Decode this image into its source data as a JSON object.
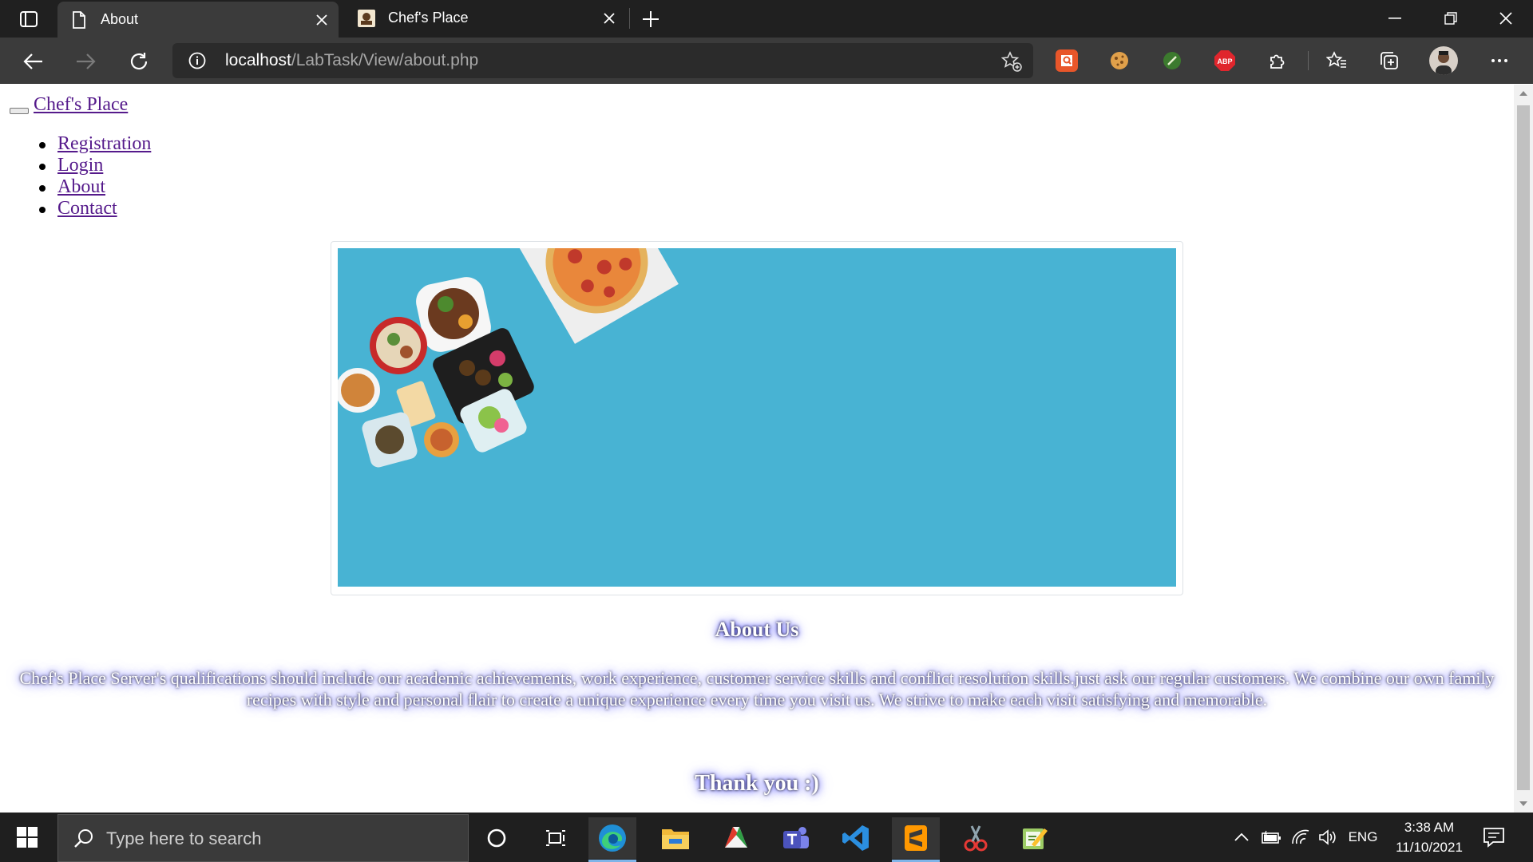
{
  "browser": {
    "tabs": [
      {
        "title": "About",
        "active": true
      },
      {
        "title": "Chef's Place",
        "active": false
      }
    ],
    "address": {
      "host": "localhost",
      "path": "/LabTask/View/about.php"
    },
    "extensions": [
      "search-extension-icon",
      "cookie-extension-icon",
      "green-leaf-extension-icon",
      "adblock-plus-icon",
      "extensions-puzzle-icon"
    ],
    "adblock_label": "ABP"
  },
  "page": {
    "brand": "Chef's Place",
    "nav": [
      {
        "label": "Registration"
      },
      {
        "label": "Login"
      },
      {
        "label": "About"
      },
      {
        "label": "Contact"
      }
    ],
    "hero": {
      "background": "#48b3d3"
    },
    "about_title": "About Us",
    "about_text": "Chef's Place Server's qualifications should include our academic achievements, work experience, customer service skills and conflict resolution skills.just ask our regular customers. We combine our own family recipes with style and personal flair to create a unique experience every time you visit us. We strive to make each visit satisfying and memorable.",
    "thanks": "Thank you :)"
  },
  "taskbar": {
    "search_placeholder": "Type here to search",
    "apps": [
      "cortana-icon",
      "task-view-icon",
      "edge-icon",
      "file-explorer-icon",
      "office-icon",
      "teams-icon",
      "vscode-icon",
      "sublime-text-icon",
      "snipping-tool-icon",
      "notepad-plus-icon"
    ],
    "language": "ENG",
    "time": "3:38 AM",
    "date": "11/10/2021"
  }
}
